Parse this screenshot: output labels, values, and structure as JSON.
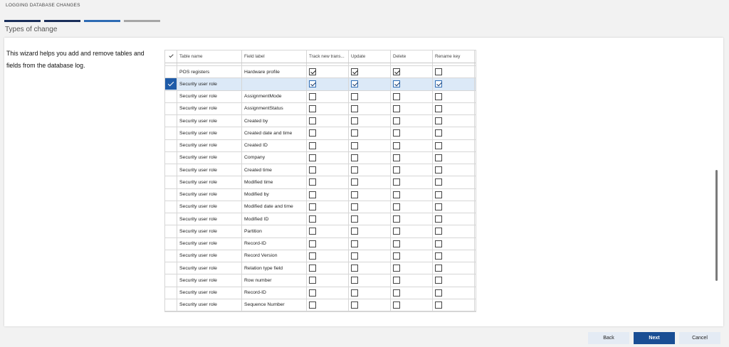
{
  "wizard": {
    "title": "LOGGING DATABASE CHANGES",
    "step_title": "Types of change",
    "intro": "This wizard helps you add and remove tables and fields from the database log."
  },
  "grid": {
    "headers": {
      "table_name": "Table name",
      "field_label": "Field label",
      "track_new": "Track new trans...",
      "update": "Update",
      "delete": "Delete",
      "rename_key": "Rename key"
    },
    "rows": [
      {
        "table": "POS registers",
        "field": "Hardware profile",
        "track": true,
        "update": true,
        "delete": true,
        "rename": false,
        "selected": false
      },
      {
        "table": "Security user role",
        "field": "",
        "track": true,
        "update": true,
        "delete": true,
        "rename": true,
        "selected": true
      },
      {
        "table": "Security user role",
        "field": "AssignmentMode",
        "track": false,
        "update": false,
        "delete": false,
        "rename": false,
        "selected": false
      },
      {
        "table": "Security user role",
        "field": "AssignmentStatus",
        "track": false,
        "update": false,
        "delete": false,
        "rename": false,
        "selected": false
      },
      {
        "table": "Security user role",
        "field": "Created by",
        "track": false,
        "update": false,
        "delete": false,
        "rename": false,
        "selected": false
      },
      {
        "table": "Security user role",
        "field": "Created date and time",
        "track": false,
        "update": false,
        "delete": false,
        "rename": false,
        "selected": false
      },
      {
        "table": "Security user role",
        "field": "Created ID",
        "track": false,
        "update": false,
        "delete": false,
        "rename": false,
        "selected": false
      },
      {
        "table": "Security user role",
        "field": "Company",
        "track": false,
        "update": false,
        "delete": false,
        "rename": false,
        "selected": false
      },
      {
        "table": "Security user role",
        "field": "Created time",
        "track": false,
        "update": false,
        "delete": false,
        "rename": false,
        "selected": false
      },
      {
        "table": "Security user role",
        "field": "Modified time",
        "track": false,
        "update": false,
        "delete": false,
        "rename": false,
        "selected": false
      },
      {
        "table": "Security user role",
        "field": "Modified by",
        "track": false,
        "update": false,
        "delete": false,
        "rename": false,
        "selected": false
      },
      {
        "table": "Security user role",
        "field": "Modified date and time",
        "track": false,
        "update": false,
        "delete": false,
        "rename": false,
        "selected": false
      },
      {
        "table": "Security user role",
        "field": "Modified ID",
        "track": false,
        "update": false,
        "delete": false,
        "rename": false,
        "selected": false
      },
      {
        "table": "Security user role",
        "field": "Partition",
        "track": false,
        "update": false,
        "delete": false,
        "rename": false,
        "selected": false
      },
      {
        "table": "Security user role",
        "field": "Record-ID",
        "track": false,
        "update": false,
        "delete": false,
        "rename": false,
        "selected": false
      },
      {
        "table": "Security user role",
        "field": "Record Version",
        "track": false,
        "update": false,
        "delete": false,
        "rename": false,
        "selected": false
      },
      {
        "table": "Security user role",
        "field": "Relation type field",
        "track": false,
        "update": false,
        "delete": false,
        "rename": false,
        "selected": false
      },
      {
        "table": "Security user role",
        "field": "Row number",
        "track": false,
        "update": false,
        "delete": false,
        "rename": false,
        "selected": false
      },
      {
        "table": "Security user role",
        "field": "Record-ID",
        "track": false,
        "update": false,
        "delete": false,
        "rename": false,
        "selected": false
      },
      {
        "table": "Security user role",
        "field": "Sequence Number",
        "track": false,
        "update": false,
        "delete": false,
        "rename": false,
        "selected": false
      }
    ]
  },
  "footer": {
    "back_label": "Back",
    "next_label": "Next",
    "cancel_label": "Cancel"
  },
  "colors": {
    "accent": "#1a4e94",
    "selected_row": "#dce9f7",
    "step_done": "#1a2e5a",
    "step_active": "#2d6bb3"
  }
}
